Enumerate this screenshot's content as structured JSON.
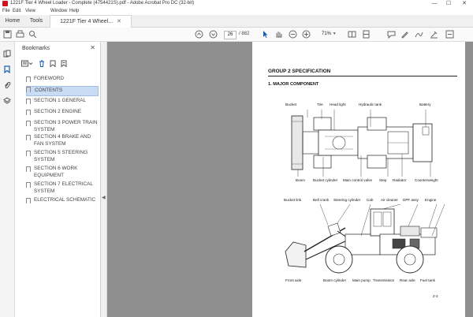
{
  "window": {
    "title": "1221F Tier 4 Wheel Loader - Complete (4754421S).pdf - Adobe Acrobat Pro DC (32-bit)",
    "minimize": "—",
    "maximize": "☐",
    "close": "✕"
  },
  "menu": [
    "File",
    "Edit",
    "View",
    "Window",
    "Help"
  ],
  "tabs": {
    "home": "Home",
    "tools": "Tools",
    "document": "1221F Tier 4 Wheel..."
  },
  "toolbar": {
    "current_page": "26",
    "page_total": "/ 882",
    "zoom": "71%"
  },
  "bookmarks": {
    "header": "Bookmarks",
    "items": [
      "FOREWORD",
      "CONTENTS",
      "SECTION 1 GENERAL",
      "SECTION 2 ENGINE",
      "SECTION 3 POWER TRAIN SYSTEM",
      "SECTION 4 BRAKE AND FAN SYSTEM",
      "SECTION 5 STEERING SYSTEM",
      "SECTION 6 WORK EQUIPMENT",
      "SECTION 7 ELECTRICAL SYSTEM",
      "ELECTRICAL SCHEMATIC"
    ],
    "selected_index": 1
  },
  "document": {
    "group_title": "GROUP 2  SPECIFICATION",
    "section_title": "1. MAJOR COMPONENT",
    "top_view_labels_top": [
      "Bucket",
      "Tire",
      "Head light",
      "Hydraulic tank",
      "Battery"
    ],
    "top_view_labels_bottom": [
      "Boom",
      "Bucket cylinder",
      "Main control valve",
      "Step",
      "Radiator",
      "Counterweight"
    ],
    "side_view_labels_top": [
      "Bucket link",
      "Bell crank",
      "Steering cylinder",
      "Cab",
      "Air cleaner",
      "DPF assy",
      "Engine"
    ],
    "side_view_labels_bottom": [
      "Front axle",
      "Boom cylinder",
      "Main pump",
      "Transmission",
      "Rear axle",
      "Fuel tank"
    ],
    "page_code": "2-2"
  },
  "colors": {
    "accent": "#d0121b",
    "doc_background": "#8f8f8f",
    "bookmark_selection": "#c9dcf4"
  }
}
